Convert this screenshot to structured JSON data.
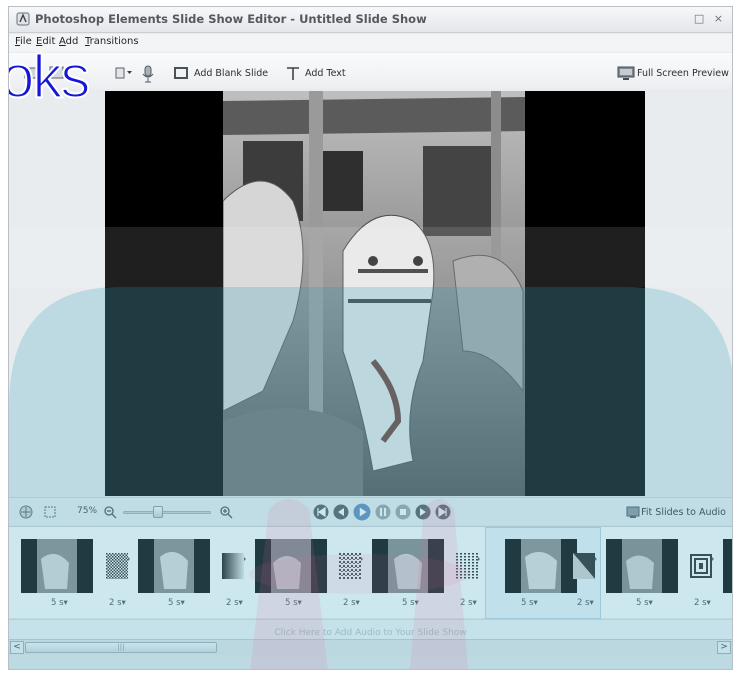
{
  "window": {
    "title": "Photoshop Elements Slide Show Editor - Untitled Slide Show",
    "controls": "□ ×"
  },
  "menu": [
    {
      "label": "File",
      "accel": "F"
    },
    {
      "label": "Edit",
      "accel": "E"
    },
    {
      "label": "Add",
      "accel": "A"
    },
    {
      "label": "Transitions",
      "accel": "T"
    }
  ],
  "toolbar": {
    "add_blank_slide": "Add Blank Slide",
    "add_text": "Add Text",
    "full_screen_preview": "Full Screen Preview"
  },
  "watermark": "oks",
  "controls": {
    "zoom": "75%",
    "fit_slides_to_audio": "Fit Slides to Audio"
  },
  "filmstrip": {
    "slide_durations": [
      "5 s▾",
      "5 s▾",
      "5 s▾",
      "5 s▾",
      "5 s▾",
      "5 s▾"
    ],
    "transition_durations": [
      "2 s▾",
      "2 s▾",
      "2 s▾",
      "2 s▾",
      "2 s▾",
      "2 s▾"
    ],
    "selected_slide_index": 4
  },
  "audio": {
    "hint": "Click Here to Add Audio to Your Slide Show"
  },
  "scrollbar": {
    "left": "<",
    "right": ">",
    "grip": "|||"
  },
  "colors": {
    "accent_blue": "#1616d8",
    "teal_overlay": "#5fb5c9",
    "pink_watermark": "#e46b9f"
  }
}
